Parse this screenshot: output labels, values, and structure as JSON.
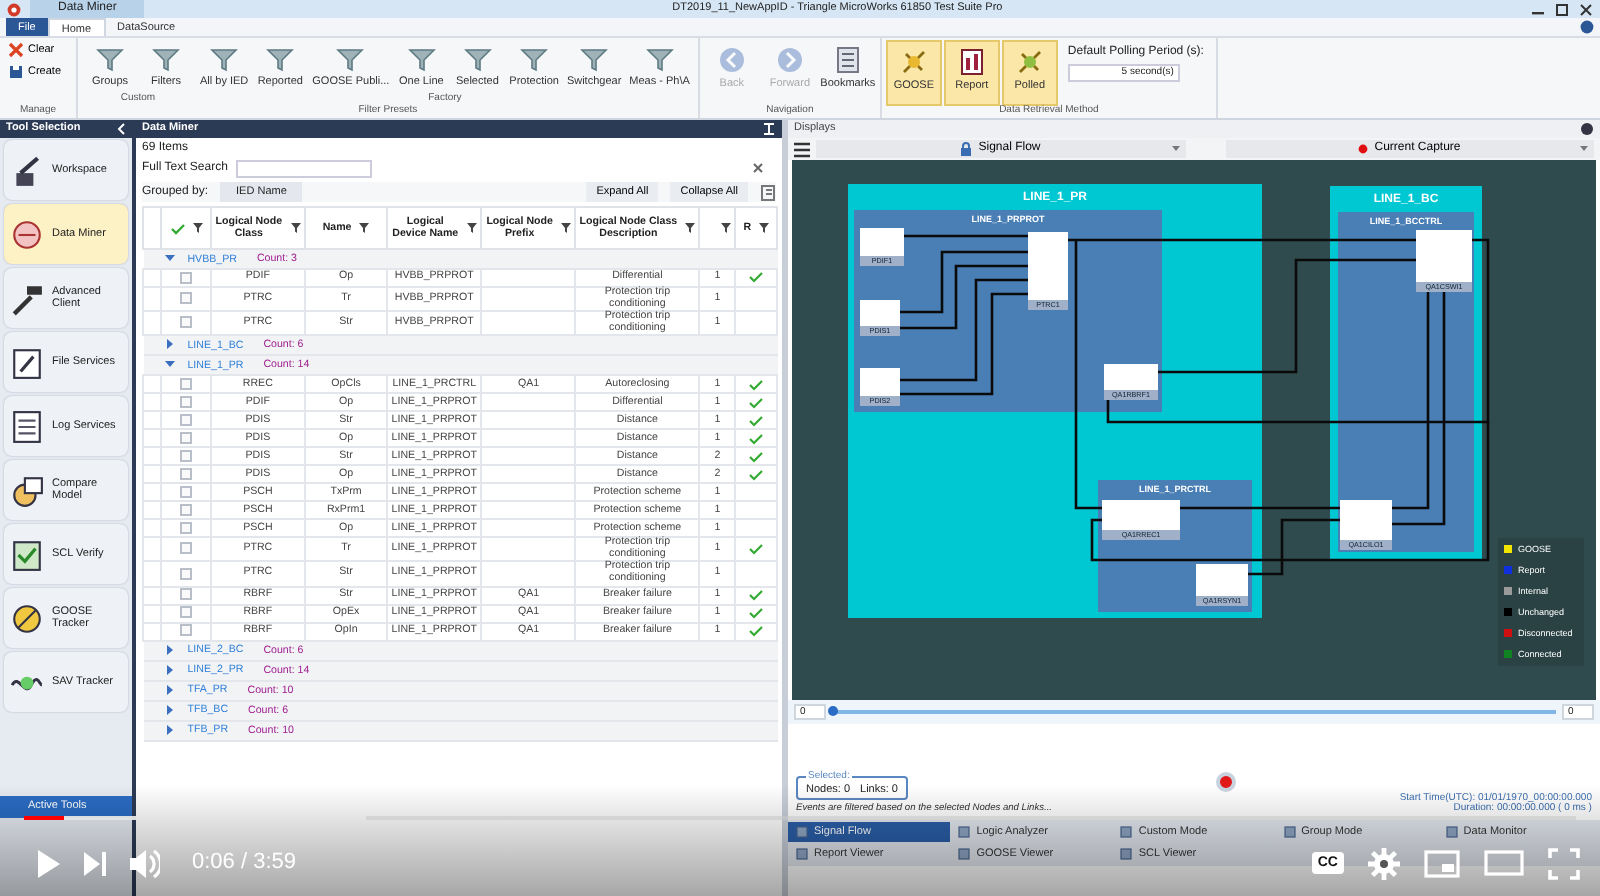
{
  "window": {
    "title": "DT2019_11_NewAppID - Triangle MicroWorks 61850 Test Suite Pro",
    "doc_tab": "Data Miner"
  },
  "ribbon_tabs": [
    {
      "label": "File",
      "selected": false
    },
    {
      "label": "Home",
      "selected": true
    },
    {
      "label": "DataSource",
      "selected": false
    }
  ],
  "manage": {
    "title": "Manage",
    "buttons": [
      "Clear",
      "Create"
    ]
  },
  "filter_presets": {
    "title": "Filter Presets",
    "subgroups": [
      {
        "title": "Custom",
        "buttons": [
          "Groups",
          "Filters"
        ]
      },
      {
        "title": "Factory",
        "buttons": [
          "All by IED",
          "Reported",
          "GOOSE Publi...",
          "One Line",
          "Selected",
          "Protection",
          "Switchgear",
          "Meas - Ph\\A"
        ]
      }
    ]
  },
  "navigation": {
    "title": "Navigation",
    "buttons": [
      {
        "label": "Back",
        "disabled": true
      },
      {
        "label": "Forward",
        "disabled": true
      },
      {
        "label": "Bookmarks",
        "disabled": false
      }
    ]
  },
  "data_retrieval": {
    "title": "Data Retrieval Method",
    "methods": [
      {
        "label": "GOOSE",
        "selected": true
      },
      {
        "label": "Report",
        "selected": true
      },
      {
        "label": "Polled",
        "selected": true
      }
    ],
    "polling_label": "Default Polling Period (s):",
    "polling_value": "5 second(s)"
  },
  "sidebar": {
    "title": "Tool Selection",
    "items": [
      {
        "label": "Workspace",
        "selected": false
      },
      {
        "label": "Data Miner",
        "selected": true
      },
      {
        "label": "Advanced Client",
        "selected": false
      },
      {
        "label": "File Services",
        "selected": false
      },
      {
        "label": "Log Services",
        "selected": false
      },
      {
        "label": "Compare Model",
        "selected": false
      },
      {
        "label": "SCL Verify",
        "selected": false
      },
      {
        "label": "GOOSE Tracker",
        "selected": false
      },
      {
        "label": "SAV Tracker",
        "selected": false
      }
    ],
    "active_tools": "Active Tools"
  },
  "data_miner": {
    "title": "Data Miner",
    "item_count": "69 Items",
    "search_label": "Full Text Search",
    "grouped_by_label": "Grouped by:",
    "group_chip": "IED Name",
    "buttons": [
      "Expand All",
      "Collapse All"
    ],
    "columns": [
      "Logical Node Class",
      "Name",
      "Logical Device Name",
      "Logical Node Prefix",
      "Logical Node Class Description",
      "R"
    ],
    "groups": [
      {
        "name": "HVBB_PR",
        "count": "Count: 3",
        "expanded": true,
        "rows": [
          {
            "checked": false,
            "cls": "PDIF",
            "name": "Op",
            "device": "HVBB_PRPROT",
            "description": "Differential",
            "column_7": "1",
            "r": true
          },
          {
            "checked": false,
            "cls": "PTRC",
            "name": "Tr",
            "device": "HVBB_PRPROT",
            "description": "Protection trip conditioning",
            "column_7": "1",
            "r": false
          },
          {
            "checked": false,
            "cls": "PTRC",
            "name": "Str",
            "device": "HVBB_PRPROT",
            "description": "Protection trip conditioning",
            "column_7": "1",
            "r": false
          }
        ]
      },
      {
        "name": "LINE_1_BC",
        "count": "Count: 6",
        "expanded": false
      },
      {
        "name": "LINE_1_PR",
        "count": "Count: 14",
        "expanded": true,
        "rows": [
          {
            "checked": false,
            "cls": "RREC",
            "name": "OpCls",
            "device": "LINE_1_PRCTRL",
            "prefix": "QA1",
            "description": "Autoreclosing",
            "column_7": "1",
            "r": true
          },
          {
            "checked": false,
            "cls": "PDIF",
            "name": "Op",
            "device": "LINE_1_PRPROT",
            "description": "Differential",
            "column_7": "1",
            "r": true
          },
          {
            "checked": false,
            "cls": "PDIS",
            "name": "Str",
            "device": "LINE_1_PRPROT",
            "description": "Distance",
            "column_7": "1",
            "r": true
          },
          {
            "checked": false,
            "cls": "PDIS",
            "name": "Op",
            "device": "LINE_1_PRPROT",
            "description": "Distance",
            "column_7": "1",
            "r": true
          },
          {
            "checked": false,
            "cls": "PDIS",
            "name": "Str",
            "device": "LINE_1_PRPROT",
            "description": "Distance",
            "column_7": "2",
            "r": true
          },
          {
            "checked": false,
            "cls": "PDIS",
            "name": "Op",
            "device": "LINE_1_PRPROT",
            "description": "Distance",
            "column_7": "2",
            "r": true
          },
          {
            "checked": false,
            "cls": "PSCH",
            "name": "TxPrm",
            "device": "LINE_1_PRPROT",
            "description": "Protection scheme",
            "column_7": "1",
            "r": false
          },
          {
            "checked": false,
            "cls": "PSCH",
            "name": "RxPrm1",
            "device": "LINE_1_PRPROT",
            "description": "Protection scheme",
            "column_7": "1",
            "r": false
          },
          {
            "checked": false,
            "cls": "PSCH",
            "name": "Op",
            "device": "LINE_1_PRPROT",
            "description": "Protection scheme",
            "column_7": "1",
            "r": false
          },
          {
            "checked": false,
            "cls": "PTRC",
            "name": "Tr",
            "device": "LINE_1_PRPROT",
            "description": "Protection trip conditioning",
            "column_7": "1",
            "r": true
          },
          {
            "checked": false,
            "cls": "PTRC",
            "name": "Str",
            "device": "LINE_1_PRPROT",
            "description": "Protection trip conditioning",
            "column_7": "1",
            "r": false
          },
          {
            "checked": false,
            "cls": "RBRF",
            "name": "Str",
            "device": "LINE_1_PRPROT",
            "prefix": "QA1",
            "description": "Breaker failure",
            "column_7": "1",
            "r": true
          },
          {
            "checked": false,
            "cls": "RBRF",
            "name": "OpEx",
            "device": "LINE_1_PRPROT",
            "prefix": "QA1",
            "description": "Breaker failure",
            "column_7": "1",
            "r": true
          },
          {
            "checked": false,
            "cls": "RBRF",
            "name": "OpIn",
            "device": "LINE_1_PRPROT",
            "prefix": "QA1",
            "description": "Breaker failure",
            "column_7": "1",
            "r": true
          }
        ]
      },
      {
        "name": "LINE_2_BC",
        "count": "Count: 6",
        "expanded": false
      },
      {
        "name": "LINE_2_PR",
        "count": "Count: 14",
        "expanded": false
      },
      {
        "name": "TFA_PR",
        "count": "Count: 10",
        "expanded": false
      },
      {
        "name": "TFB_BC",
        "count": "Count: 6",
        "expanded": false
      },
      {
        "name": "TFB_PR",
        "count": "Count: 10",
        "expanded": false
      }
    ]
  },
  "displays": {
    "title": "Displays",
    "view": "Signal Flow",
    "capture": "Current Capture",
    "signal_flow": {
      "areas": [
        {
          "title": "LINE_1_PR",
          "devices": [
            {
              "title": "LINE_1_PRPROT",
              "nodes": [
                "PDIF1",
                "PDIS1",
                "PDIS2",
                "PTRC1",
                "QA1RBRF1"
              ]
            },
            {
              "title": "LINE_1_PRCTRL",
              "nodes": [
                "QA1RREC1",
                "QA1RSYN1"
              ]
            }
          ]
        },
        {
          "title": "LINE_1_BC",
          "devices": [
            {
              "title": "LINE_1_BCCTRL",
              "nodes": [
                "QA1CSWI1",
                "QA1CILO1"
              ]
            }
          ]
        }
      ],
      "legend": [
        {
          "label": "GOOSE",
          "color": "#f2e600"
        },
        {
          "label": "Report",
          "color": "#1030e0"
        },
        {
          "label": "Internal",
          "color": "#9a9a9a"
        },
        {
          "label": "Unchanged",
          "color": "#000000"
        },
        {
          "label": "Disconnected",
          "color": "#d01010"
        },
        {
          "label": "Connected",
          "color": "#108020"
        }
      ]
    },
    "timeline": {
      "min": "0",
      "max": "0",
      "level": 0
    },
    "selected": {
      "title": "Selected:",
      "nodes": "Nodes: 0",
      "links": "Links: 0"
    },
    "filter_note": "Events are filtered based on the selected Nodes and Links...",
    "start_time": "Start Time(UTC): 01/01/1970_00:00:00.000",
    "duration": "Duration: 00:00:00.000 ( 0 ms )",
    "modes": [
      {
        "label": "Signal Flow",
        "selected": true
      },
      {
        "label": "Logic Analyzer",
        "selected": false
      },
      {
        "label": "Custom Mode",
        "selected": false
      },
      {
        "label": "Group Mode",
        "selected": false
      },
      {
        "label": "Data Monitor",
        "selected": false
      },
      {
        "label": "Report Viewer",
        "selected": false
      },
      {
        "label": "GOOSE Viewer",
        "selected": false
      },
      {
        "label": "SCL Viewer",
        "selected": false
      }
    ]
  },
  "video_player": {
    "progress": {
      "level": 0.026
    },
    "buffer": {
      "level": 0.22
    },
    "time": "0:06 / 3:59",
    "captions": "CC"
  }
}
